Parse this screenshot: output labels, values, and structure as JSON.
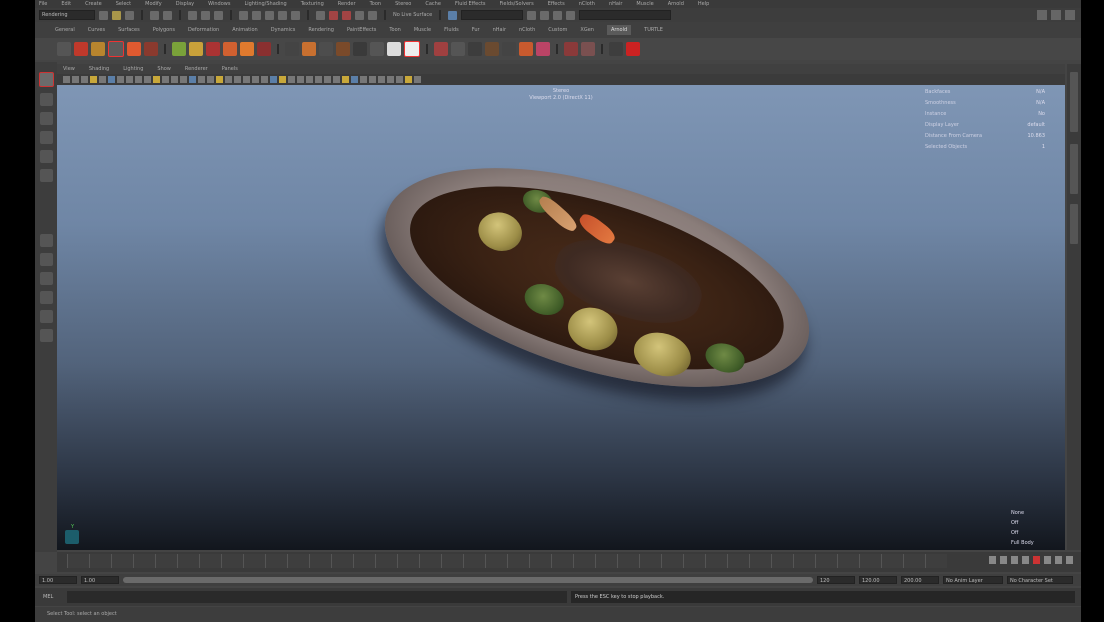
{
  "menubar": {
    "items": [
      "File",
      "Edit",
      "Create",
      "Select",
      "Modify",
      "Display",
      "Windows",
      "Lighting/Shading",
      "Texturing",
      "Render",
      "Toon",
      "Stereo",
      "Cache",
      "Fluid Effects",
      "Fields/Solvers",
      "Effects",
      "nCloth",
      "nHair",
      "Muscle",
      "Arnold",
      "Help"
    ]
  },
  "statusline": {
    "mode": "Rendering",
    "live_surface": "No Live Surface"
  },
  "shelf": {
    "tabs": [
      "General",
      "Curves",
      "Surfaces",
      "Polygons",
      "Deformation",
      "Animation",
      "Dynamics",
      "Rendering",
      "PaintEffects",
      "Toon",
      "Muscle",
      "Fluids",
      "Fur",
      "nHair",
      "nCloth",
      "Custom",
      "XGen",
      "Arnold",
      "TURTLE"
    ],
    "active_tab": "Arnold"
  },
  "panel_menu": {
    "items": [
      "View",
      "Shading",
      "Lighting",
      "Show",
      "Renderer",
      "Panels"
    ]
  },
  "viewport": {
    "camera": "Stereo",
    "title": "Viewport 2.0 (DirectX 11)",
    "hud": [
      {
        "label": "Backfaces",
        "value": "N/A"
      },
      {
        "label": "Smoothness",
        "value": "N/A"
      },
      {
        "label": "Instance",
        "value": "No"
      },
      {
        "label": "Display Layer",
        "value": "default"
      },
      {
        "label": "Distance From Camera",
        "value": "10.863"
      },
      {
        "label": "Selected Objects",
        "value": "1"
      }
    ],
    "hud_bottom": [
      "None",
      "Off",
      "Off",
      "Full Body"
    ],
    "axis_label": "Y"
  },
  "range": {
    "start": "1.00",
    "start2": "1.00",
    "end": "120",
    "end2": "120.00",
    "end3": "200.00",
    "anim_layer": "No Anim Layer",
    "char_set": "No Character Set"
  },
  "cmdline": {
    "label": "MEL",
    "message": "Press the ESC key to stop playback."
  },
  "helpline": {
    "text": "Select Tool: select an object"
  }
}
